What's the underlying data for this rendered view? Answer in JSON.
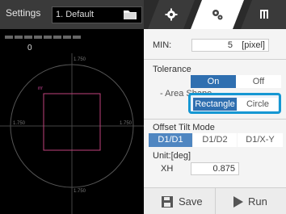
{
  "header": {
    "settings_label": "Settings",
    "settings_value": "1. Default"
  },
  "icons": {
    "folder": "folder-icon",
    "tab1": "gear-icon",
    "tab2": "gears-icon",
    "tab3": "io-icon"
  },
  "viewer": {
    "value": "0",
    "tick_top": "1.750",
    "tick_left": "1.750",
    "tick_right": "1.750",
    "tick_bottom": "1.750",
    "colors": {
      "circle": "#555555",
      "square": "#c0427b",
      "marker": "#d54aa0"
    }
  },
  "panel": {
    "min_label": "MIN:",
    "min_value": "5",
    "min_unit": "[pixel]",
    "tolerance_label": "Tolerance",
    "tolerance_on": "On",
    "tolerance_off": "Off",
    "area_shape_label": "- Area Shape",
    "area_shape_rectangle": "Rectangle",
    "area_shape_circle": "Circle",
    "offset_tilt_label": "Offset Tilt Mode",
    "offset_d1d1": "D1/D1",
    "offset_d1d2": "D1/D2",
    "offset_d1xy": "D1/X-Y",
    "unit_label": "Unit:[deg]",
    "xh_label": "XH",
    "xh_value": "0.875"
  },
  "footer": {
    "save": "Save",
    "run": "Run"
  },
  "colors": {
    "accent": "#2f6fb0",
    "highlight": "#1597d3"
  }
}
